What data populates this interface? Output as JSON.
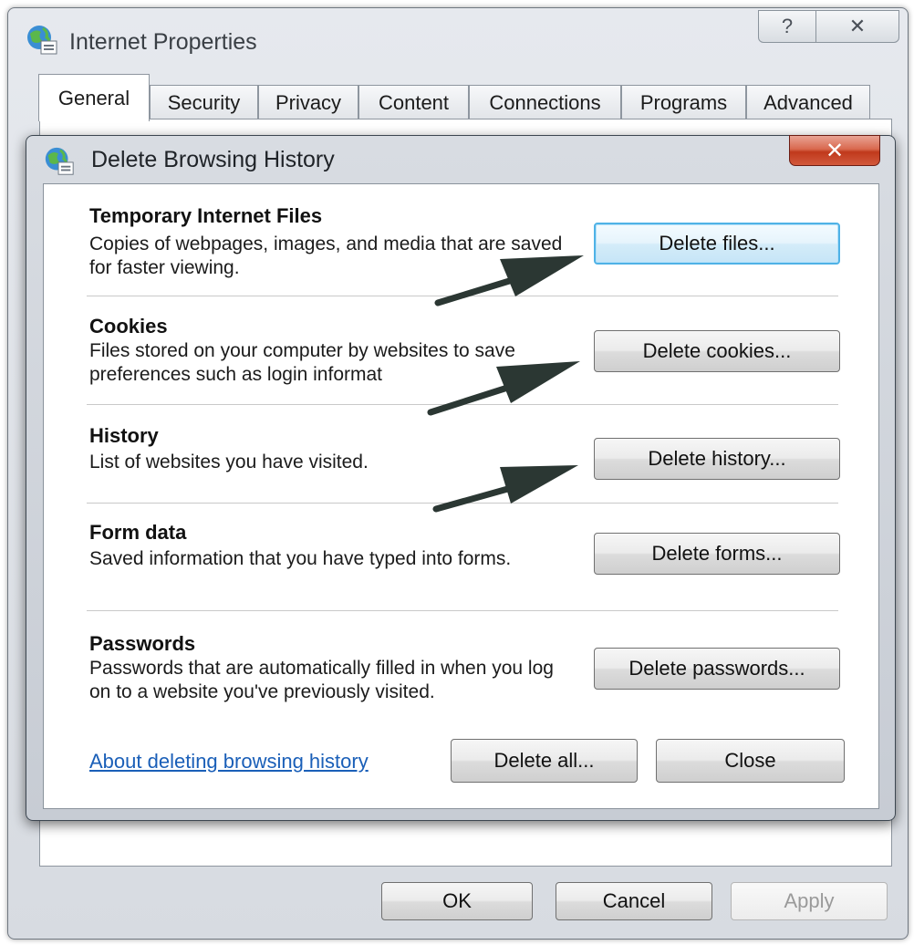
{
  "outer_window": {
    "title": "Internet Properties",
    "help_glyph": "?",
    "close_glyph": "✕",
    "tabs": [
      {
        "label": "General",
        "active": true
      },
      {
        "label": "Security",
        "active": false
      },
      {
        "label": "Privacy",
        "active": false
      },
      {
        "label": "Content",
        "active": false
      },
      {
        "label": "Connections",
        "active": false
      },
      {
        "label": "Programs",
        "active": false
      },
      {
        "label": "Advanced",
        "active": false
      }
    ],
    "footer_buttons": {
      "ok": "OK",
      "cancel": "Cancel",
      "apply": "Apply"
    },
    "icon": "internet-options-globe-icon"
  },
  "dialog": {
    "title": "Delete Browsing History",
    "close_glyph": "✕",
    "icon": "internet-options-globe-icon",
    "sections": [
      {
        "title": "Temporary Internet Files",
        "description": "Copies of webpages, images, and media that are saved for faster viewing.",
        "button": "Delete files..."
      },
      {
        "title": "Cookies",
        "description": "Files stored on your computer by websites to save preferences such as login informat",
        "button": "Delete cookies..."
      },
      {
        "title": "History",
        "description": "List of websites you have visited.",
        "button": "Delete history..."
      },
      {
        "title": "Form data",
        "description": "Saved information that you have typed into forms.",
        "button": "Delete forms..."
      },
      {
        "title": "Passwords",
        "description": "Passwords that are automatically filled in when you log on to a website you've previously visited.",
        "button": "Delete passwords..."
      }
    ],
    "link": "About deleting browsing history",
    "delete_all": "Delete all...",
    "close": "Close"
  },
  "colors": {
    "link": "#1a5fb8",
    "focus_border": "#4fb2e6",
    "close_red": "#c0391c",
    "annotation_arrow": "#2b3733"
  }
}
